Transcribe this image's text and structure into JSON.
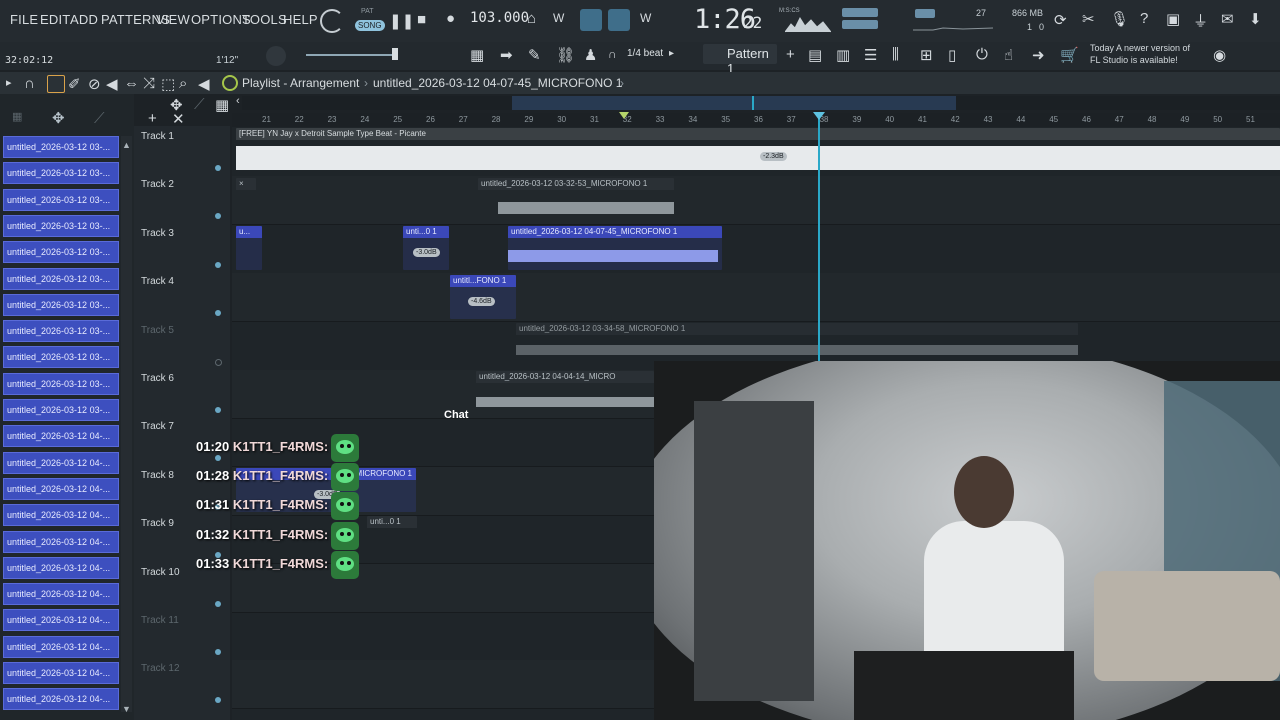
{
  "menu": [
    "FILE",
    "EDIT",
    "ADD",
    "PATTERNS",
    "VIEW",
    "OPTIONS",
    "TOOLS",
    "HELP"
  ],
  "transport": {
    "mode_top": "PAT",
    "mode_bottom": "SONG",
    "tempo": "103.000",
    "time": "1:26",
    "time_sub": "22",
    "time_unit": "M:S:CS"
  },
  "stats": {
    "cpu_value": "27",
    "memory": "866 MB",
    "voices": "1",
    "cpu_extra": "0"
  },
  "bar2": {
    "clock": "32:02:12",
    "bars": "1'12\"",
    "snap": "1/4 beat",
    "pattern": "Pattern 1"
  },
  "news": {
    "line1": "Today  A newer version of",
    "line2": "FL Studio is available!"
  },
  "playlist": {
    "title": "Playlist - Arrangement",
    "separator": "›",
    "file": "untitled_2026-03-12 04-07-45_MICROFONO 1",
    "separator2": "›"
  },
  "browser_items": [
    "untitled_2026-03-12 03-...",
    "untitled_2026-03-12 03-...",
    "untitled_2026-03-12 03-...",
    "untitled_2026-03-12 03-...",
    "untitled_2026-03-12 03-...",
    "untitled_2026-03-12 03-...",
    "untitled_2026-03-12 03-...",
    "untitled_2026-03-12 03-...",
    "untitled_2026-03-12 03-...",
    "untitled_2026-03-12 03-...",
    "untitled_2026-03-12 03-...",
    "untitled_2026-03-12 04-...",
    "untitled_2026-03-12 04-...",
    "untitled_2026-03-12 04-...",
    "untitled_2026-03-12 04-...",
    "untitled_2026-03-12 04-...",
    "untitled_2026-03-12 04-...",
    "untitled_2026-03-12 04-...",
    "untitled_2026-03-12 04-...",
    "untitled_2026-03-12 04-...",
    "untitled_2026-03-12 04-...",
    "untitled_2026-03-12 04-..."
  ],
  "tracks": [
    "Track 1",
    "Track 2",
    "Track 3",
    "Track 4",
    "Track 5",
    "Track 6",
    "Track 7",
    "Track 8",
    "Track 9",
    "Track 10",
    "Track 11",
    "Track 12"
  ],
  "ruler": [
    "21",
    "22",
    "23",
    "24",
    "25",
    "26",
    "27",
    "28",
    "29",
    "30",
    "31",
    "32",
    "33",
    "34",
    "35",
    "36",
    "37",
    "38",
    "39",
    "40",
    "41",
    "42",
    "43",
    "44",
    "45",
    "46",
    "47",
    "48",
    "49",
    "50",
    "51"
  ],
  "clips": {
    "t1": "[FREE] YN Jay x Detroit Sample Type Beat - Picante",
    "t2": "untitled_2026-03-12 03-32-53_MICROFONO 1",
    "t3a": "u...",
    "t3b": "unti...0 1",
    "t3c": "untitled_2026-03-12 04-07-45_MICROFONO 1",
    "t4": "untitl...FONO 1",
    "t5": "untitled_2026-03-12 03-34-58_MICROFONO 1",
    "t6": "untitled_2026-03-12 04-04-14_MICRO",
    "t8": "MICROFONO 1",
    "t9": "unti...0 1"
  },
  "gains": {
    "t1": "-2.3dB",
    "t3": "-3.0dB",
    "t4": "-4.6dB",
    "t8": "-3.0dB"
  },
  "chat": {
    "label": "Chat",
    "messages": [
      {
        "time": "01:20",
        "user": "K1TT1_F4RMS:"
      },
      {
        "time": "01:28",
        "user": "K1TT1_F4RMS:"
      },
      {
        "time": "01:31",
        "user": "K1TT1_F4RMS:"
      },
      {
        "time": "01:32",
        "user": "K1TT1_F4RMS:"
      },
      {
        "time": "01:33",
        "user": "K1TT1_F4RMS:"
      }
    ]
  },
  "colors": {
    "accent": "#2aa8c8",
    "clip_blue": "#3b48b9",
    "browser_item": "#3d4fbf"
  }
}
